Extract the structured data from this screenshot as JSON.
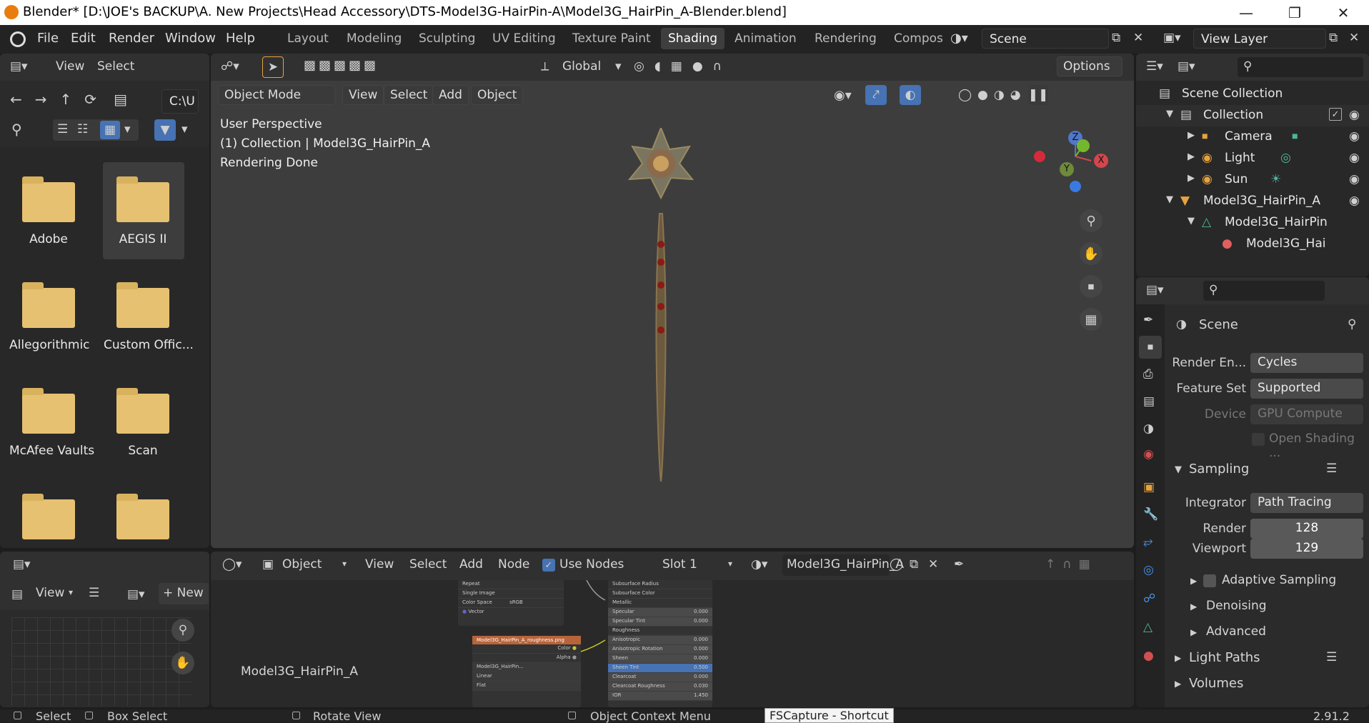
{
  "window": {
    "title": "Blender* [D:\\JOE's BACKUP\\A. New Projects\\Head Accessory\\DTS-Model3G-HairPin-A\\Model3G_HairPin_A-Blender.blend]"
  },
  "menu": [
    "File",
    "Edit",
    "Render",
    "Window",
    "Help"
  ],
  "workspaces": [
    "Layout",
    "Modeling",
    "Sculpting",
    "UV Editing",
    "Texture Paint",
    "Shading",
    "Animation",
    "Rendering",
    "Compos"
  ],
  "active_workspace": "Shading",
  "scene": "Scene",
  "view_layer": "View Layer",
  "filebrowser": {
    "header": [
      "View",
      "Select"
    ],
    "path": "C:\\U",
    "folders": [
      "Adobe",
      "AEGIS II",
      "Allegorithmic",
      "Custom Offic...",
      "McAfee Vaults",
      "Scan",
      "",
      ""
    ]
  },
  "viewport": {
    "mode": "Object Mode",
    "menus": [
      "View",
      "Select",
      "Add",
      "Object"
    ],
    "transform": "Global",
    "options": "Options",
    "info": [
      "User Perspective",
      "(1) Collection | Model3G_HairPin_A",
      "Rendering Done"
    ],
    "gizmo": {
      "z": "Z",
      "y": "Y",
      "x": "X"
    }
  },
  "outliner": {
    "items": [
      {
        "label": "Scene Collection",
        "level": 0
      },
      {
        "label": "Collection",
        "level": 1
      },
      {
        "label": "Camera",
        "level": 2
      },
      {
        "label": "Light",
        "level": 2
      },
      {
        "label": "Sun",
        "level": 2
      },
      {
        "label": "Model3G_HairPin_A",
        "level": 1
      },
      {
        "label": "Model3G_HairPin",
        "level": 2
      },
      {
        "label": "Model3G_Hai",
        "level": 3
      }
    ]
  },
  "properties": {
    "title": "Scene",
    "render_engine_label": "Render En...",
    "render_engine": "Cycles",
    "feature_set_label": "Feature Set",
    "feature_set": "Supported",
    "device_label": "Device",
    "device": "GPU Compute",
    "open_shading": "Open Shading ...",
    "sampling": "Sampling",
    "integrator_label": "Integrator",
    "integrator": "Path Tracing",
    "render_label": "Render",
    "render_samples": "128",
    "viewport_label": "Viewport",
    "viewport_samples": "129",
    "adaptive": "Adaptive Sampling",
    "denoising": "Denoising",
    "advanced": "Advanced",
    "light_paths": "Light Paths",
    "volumes": "Volumes"
  },
  "image_editor": {
    "view": "View",
    "new": "New"
  },
  "node_editor": {
    "object": "Object",
    "menus": [
      "View",
      "Select",
      "Add",
      "Node"
    ],
    "use_nodes": "Use Nodes",
    "slot": "Slot 1",
    "material": "Model3G_HairPin_A",
    "label": "Model3G_HairPin_A",
    "tex_rows": [
      "Repeat",
      "Single Image",
      "Color Space",
      "sRGB",
      "Vector"
    ],
    "rough_title": "Model3G_HairPin_A_roughness.png",
    "rough_rows": [
      "Color",
      "Alpha",
      "Model3G_HairPin...",
      "Linear",
      "Flat"
    ],
    "bsdf_rows": [
      [
        "Subsurface Radius",
        ""
      ],
      [
        "Subsurface Color",
        ""
      ],
      [
        "Metallic",
        ""
      ],
      [
        "Specular",
        "0.000"
      ],
      [
        "Specular Tint",
        "0.000"
      ],
      [
        "Roughness",
        ""
      ],
      [
        "Anisotropic",
        "0.000"
      ],
      [
        "Anisotropic Rotation",
        "0.000"
      ],
      [
        "Sheen",
        "0.000"
      ],
      [
        "Sheen Tint",
        "0.500"
      ],
      [
        "Clearcoat",
        "0.000"
      ],
      [
        "Clearcoat Roughness",
        "0.030"
      ],
      [
        "IOR",
        "1.450"
      ]
    ]
  },
  "statusbar": {
    "select": "Select",
    "box_select": "Box Select",
    "rotate": "Rotate View",
    "context": "Object Context Menu",
    "tooltip": "FSCapture - Shortcut",
    "version": "2.91.2"
  }
}
